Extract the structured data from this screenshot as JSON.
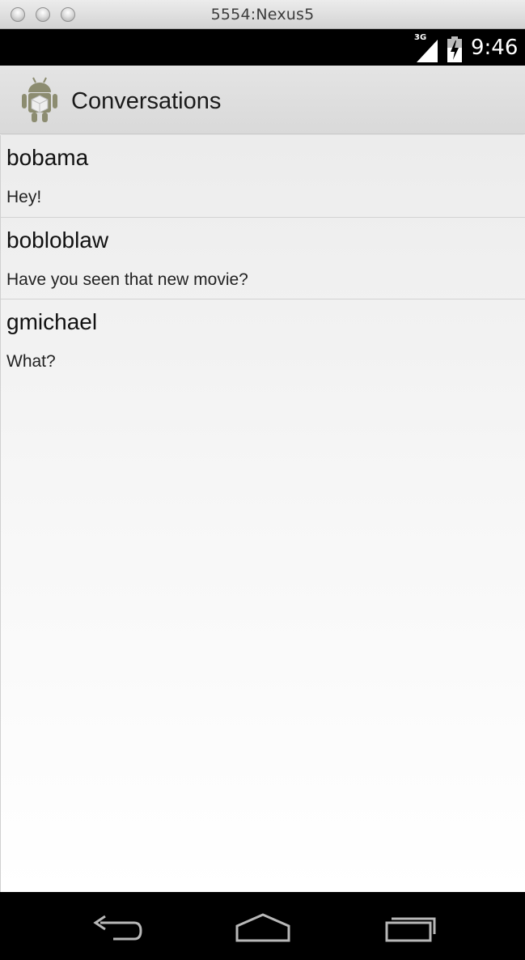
{
  "window": {
    "title": "5554:Nexus5"
  },
  "status_bar": {
    "network_type": "3G",
    "time": "9:46",
    "icons": [
      "signal-icon",
      "battery-charging-icon"
    ]
  },
  "action_bar": {
    "title": "Conversations",
    "icon": "android-app-icon"
  },
  "conversations": [
    {
      "name": "bobama",
      "message": "Hey!"
    },
    {
      "name": "bobloblaw",
      "message": "Have you seen that new movie?"
    },
    {
      "name": "gmichael",
      "message": "What?"
    }
  ],
  "nav_bar": {
    "icons": [
      "back-icon",
      "home-icon",
      "recent-apps-icon"
    ]
  },
  "colors": {
    "status_bar": "#000000",
    "action_bar": "#dedede",
    "nav_bar": "#000000",
    "text": "#111111"
  }
}
